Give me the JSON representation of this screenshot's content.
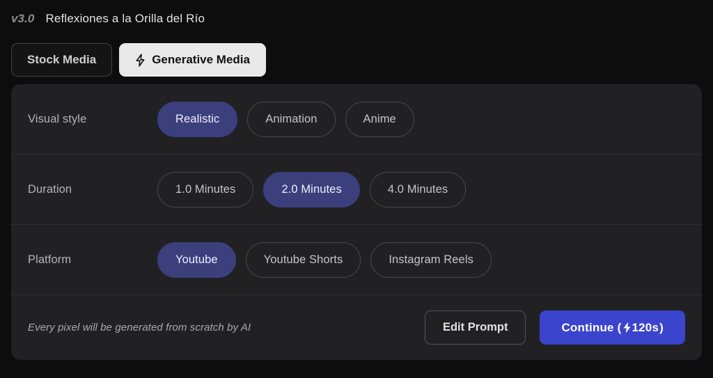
{
  "header": {
    "version": "v3.0",
    "title": "Reflexiones a la Orilla del Río"
  },
  "mode_tabs": {
    "items": [
      {
        "label": "Stock Media",
        "active": false,
        "icon": ""
      },
      {
        "label": "Generative Media",
        "active": true,
        "icon": "lightning-bolt-icon"
      }
    ]
  },
  "options": [
    {
      "label": "Visual style",
      "choices": [
        {
          "label": "Realistic",
          "selected": true
        },
        {
          "label": "Animation",
          "selected": false
        },
        {
          "label": "Anime",
          "selected": false
        }
      ]
    },
    {
      "label": "Duration",
      "choices": [
        {
          "label": "1.0 Minutes",
          "selected": false
        },
        {
          "label": "2.0 Minutes",
          "selected": true
        },
        {
          "label": "4.0 Minutes",
          "selected": false
        }
      ]
    },
    {
      "label": "Platform",
      "choices": [
        {
          "label": "Youtube",
          "selected": true
        },
        {
          "label": "Youtube Shorts",
          "selected": false
        },
        {
          "label": "Instagram Reels",
          "selected": false
        }
      ]
    }
  ],
  "footer": {
    "note": "Every pixel will be generated from scratch by AI",
    "edit_label": "Edit Prompt",
    "continue_prefix": "Continue (",
    "continue_cost": "120s",
    "continue_suffix": ")",
    "continue_icon": "lightning-bolt-icon"
  },
  "colors": {
    "page_bg": "#0d0d0d",
    "card_bg": "#212123",
    "divider": "#2e2e31",
    "pill_selected": "#3b3f7c",
    "pill_border": "#4a4a4e",
    "accent_blue": "#3b44cc",
    "tab_active_bg": "#e9e9e9",
    "muted_text": "#b4b4ba"
  }
}
